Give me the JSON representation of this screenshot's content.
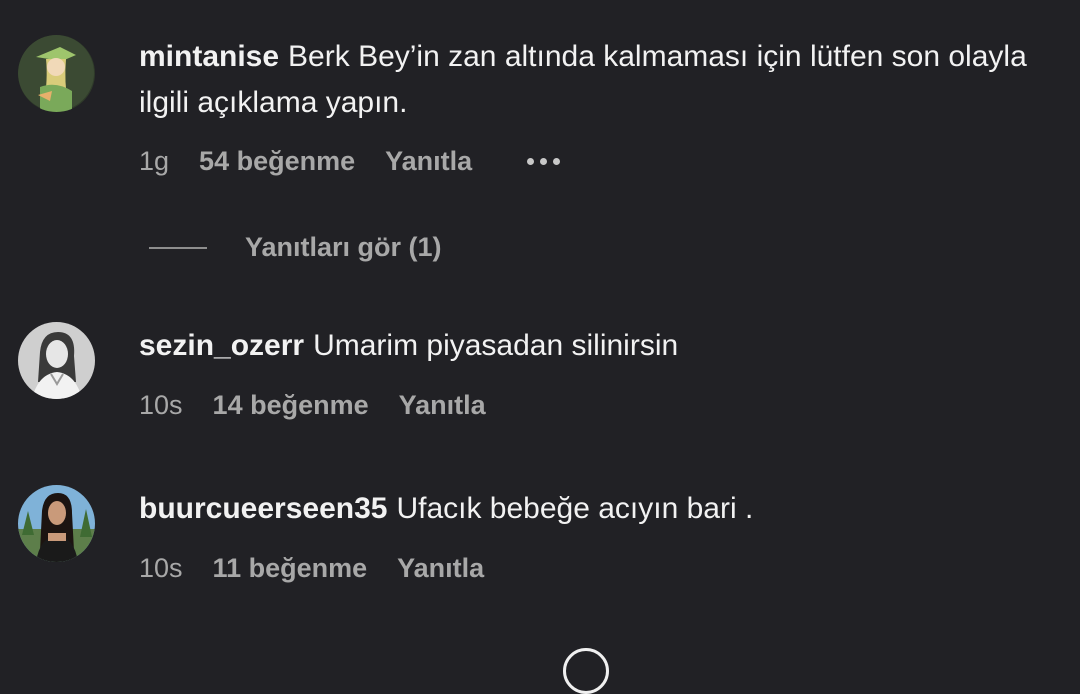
{
  "comments": [
    {
      "username": "mintanise",
      "text": "Berk Bey’in zan altında kalmaması için lütfen son olayla ilgili açıklama yapın.",
      "time": "1g",
      "likes": "54 beğenme",
      "reply": "Yanıtla",
      "view_replies": "Yanıtları gör (1)"
    },
    {
      "username": "sezin_ozerr",
      "text": "Umarim piyasadan silinirsin",
      "time": "10s",
      "likes": "14 beğenme",
      "reply": "Yanıtla"
    },
    {
      "username": "buurcueerseen35",
      "text": "Ufacık bebeğe acıyın bari .",
      "time": "10s",
      "likes": "11 beğenme",
      "reply": "Yanıtla"
    }
  ],
  "icons": {
    "more": "more-options-icon",
    "loader": "loading-spinner-icon"
  },
  "colors": {
    "background": "#212125",
    "text": "#f2f2f2",
    "secondary": "#a8a8a8"
  }
}
